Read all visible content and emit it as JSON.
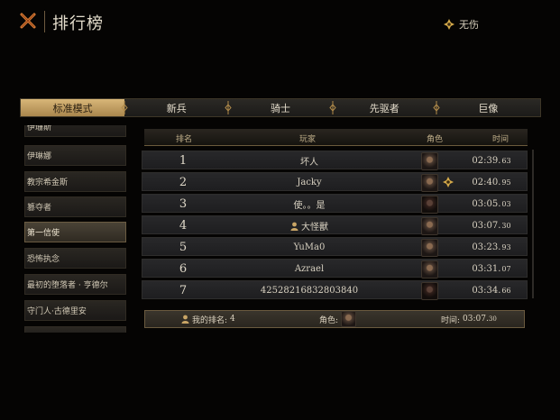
{
  "header": {
    "title": "排行榜",
    "close_icon": "close-x-icon",
    "status_label": "无伤",
    "status_icon": "diamond-emblem-icon"
  },
  "tabs": [
    {
      "label": "标准模式",
      "active": true
    },
    {
      "label": "新兵",
      "active": false
    },
    {
      "label": "骑士",
      "active": false
    },
    {
      "label": "先驱者",
      "active": false
    },
    {
      "label": "巨像",
      "active": false
    }
  ],
  "sidebar": {
    "items": [
      {
        "label": "伊珊斯",
        "active": false
      },
      {
        "label": "伊琳娜",
        "active": false
      },
      {
        "label": "教宗希金斯",
        "active": false
      },
      {
        "label": "篡夺者",
        "active": false
      },
      {
        "label": "第一信使",
        "active": true
      },
      {
        "label": "恐怖执念",
        "active": false
      },
      {
        "label": "最初的堕落者 · 亨德尔",
        "active": false
      },
      {
        "label": "守门人·古德里安",
        "active": false
      },
      {
        "label": "",
        "active": false
      }
    ]
  },
  "table": {
    "headers": {
      "rank": "排名",
      "player": "玩家",
      "hero": "角色",
      "time": "时间"
    },
    "rows": [
      {
        "rank": "1",
        "player": "坏人",
        "time": "02:39.",
        "ms": "63",
        "user_icon": false,
        "badge": false,
        "portrait": "hero-portrait-icon"
      },
      {
        "rank": "2",
        "player": "Jacky",
        "time": "02:40.",
        "ms": "95",
        "user_icon": false,
        "badge": true,
        "portrait": "hero-portrait-icon"
      },
      {
        "rank": "3",
        "player": "使。。是",
        "time": "03:05.",
        "ms": "03",
        "user_icon": false,
        "badge": false,
        "portrait": "hero-portrait-dark-icon"
      },
      {
        "rank": "4",
        "player": "大怪獸",
        "time": "03:07.",
        "ms": "30",
        "user_icon": true,
        "badge": false,
        "portrait": "hero-portrait-icon"
      },
      {
        "rank": "5",
        "player": "YuMa0",
        "time": "03:23.",
        "ms": "93",
        "user_icon": false,
        "badge": false,
        "portrait": "hero-portrait-icon"
      },
      {
        "rank": "6",
        "player": "Azrael",
        "time": "03:31.",
        "ms": "07",
        "user_icon": false,
        "badge": false,
        "portrait": "hero-portrait-icon"
      },
      {
        "rank": "7",
        "player": "42528216832803840",
        "time": "03:34.",
        "ms": "66",
        "user_icon": false,
        "badge": false,
        "portrait": "hero-portrait-dark-icon"
      }
    ]
  },
  "footer": {
    "my_rank_label": "我的排名:",
    "my_rank_value": "4",
    "hero_label": "角色:",
    "time_label": "时间:",
    "time_value": "03:07.",
    "time_ms": "30"
  },
  "colors": {
    "background": "#050403",
    "active_tab": "#c9a566",
    "accent_gold": "#d4a94a"
  }
}
